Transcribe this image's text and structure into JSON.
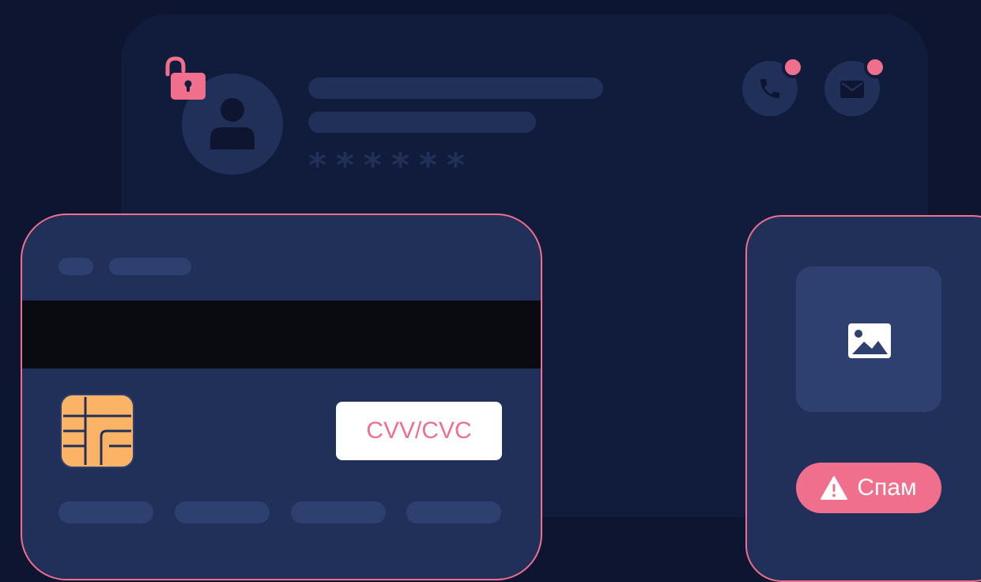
{
  "profile": {
    "password_mask": "******",
    "icons": [
      "lock-open-icon",
      "user-icon",
      "phone-icon",
      "mail-icon"
    ]
  },
  "card": {
    "cvv_label": "CVV/CVC",
    "icons": [
      "chip-icon"
    ]
  },
  "phone": {
    "spam_label": "Спам",
    "icons": [
      "image-icon",
      "warning-icon"
    ]
  },
  "colors": {
    "background": "#0d1530",
    "panel": "#111c3c",
    "surface": "#213058",
    "surface_light": "#2e4070",
    "accent": "#ef6f8c",
    "chip": "#fbb465",
    "stripe": "#0a0b10"
  }
}
